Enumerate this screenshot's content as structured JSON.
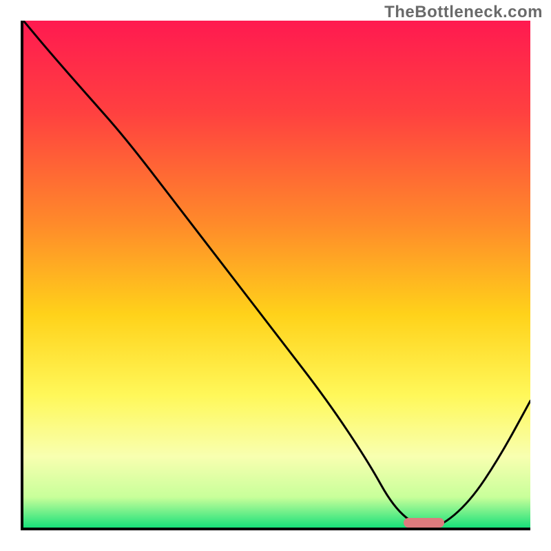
{
  "watermark": "TheBottleneck.com",
  "chart_data": {
    "type": "line",
    "title": "",
    "xlabel": "",
    "ylabel": "",
    "xlim": [
      0,
      100
    ],
    "ylim": [
      0,
      100
    ],
    "grid": false,
    "legend": false,
    "gradient_stops": [
      {
        "offset": 0,
        "color": "#ff1a50"
      },
      {
        "offset": 18,
        "color": "#ff4040"
      },
      {
        "offset": 40,
        "color": "#ff8a2a"
      },
      {
        "offset": 58,
        "color": "#ffd21a"
      },
      {
        "offset": 74,
        "color": "#fff85a"
      },
      {
        "offset": 86,
        "color": "#f8ffb0"
      },
      {
        "offset": 94,
        "color": "#c8ff9a"
      },
      {
        "offset": 100,
        "color": "#18e07a"
      }
    ],
    "series": [
      {
        "name": "bottleneck-curve",
        "x": [
          0,
          5,
          12,
          20,
          30,
          40,
          50,
          60,
          68,
          73,
          78,
          82,
          88,
          94,
          100
        ],
        "y": [
          100,
          94,
          86,
          77,
          64,
          51,
          38,
          25,
          13,
          4,
          0,
          0,
          5,
          14,
          25
        ]
      }
    ],
    "annotations": [
      {
        "name": "optimal-marker",
        "x_start": 75,
        "x_end": 83,
        "y": 0,
        "color": "#dd7b7e"
      }
    ]
  }
}
